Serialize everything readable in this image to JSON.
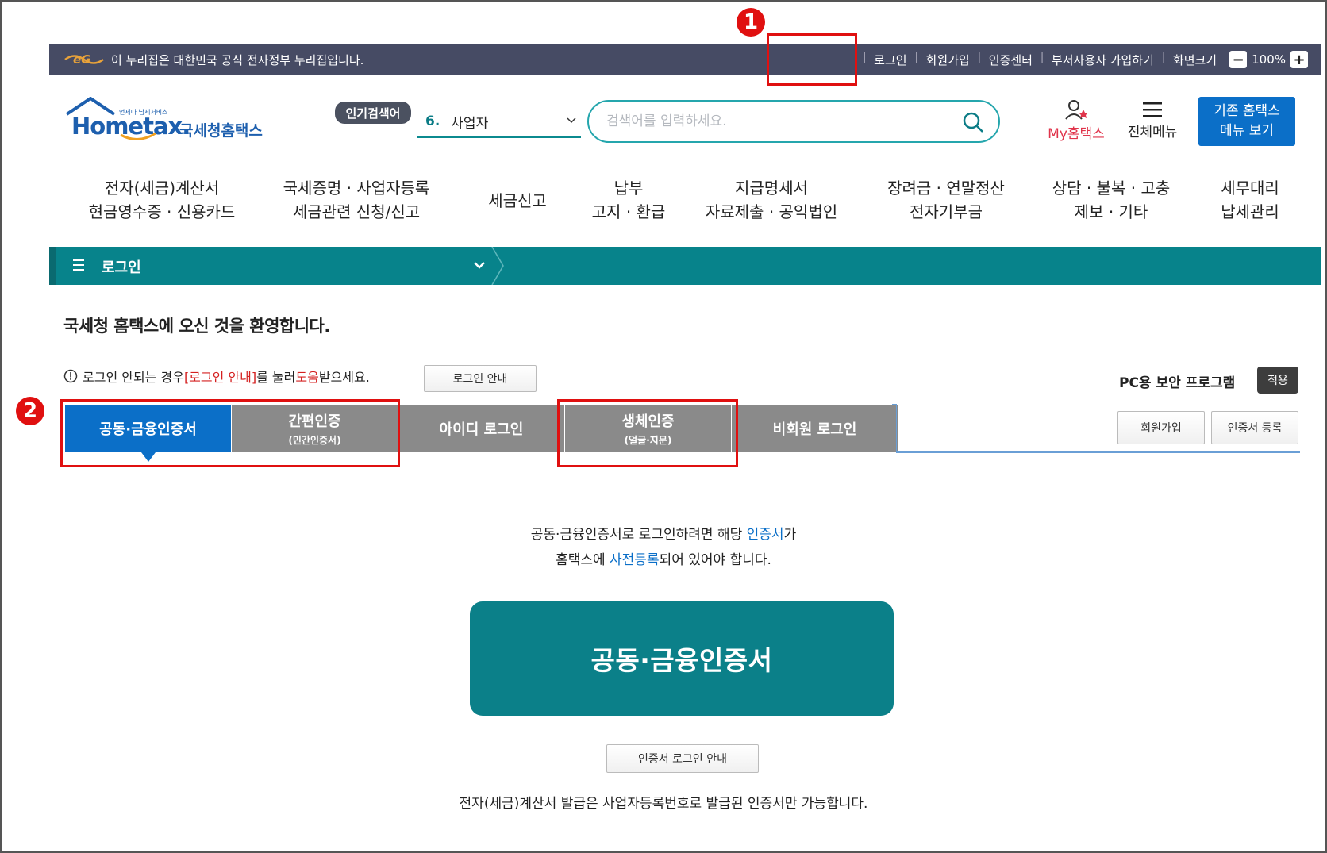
{
  "govbar": {
    "text": "이 누리집은 대한민국 공식 전자정부 누리집입니다.",
    "login": "로그인",
    "signup": "회원가입",
    "cert_center": "인증센터",
    "dept_signup": "부서사용자 가입하기",
    "screen_size": "화면크기",
    "zoom_minus": "−",
    "zoom_value": "100%",
    "zoom_plus": "+"
  },
  "header": {
    "logo_small": "언제나 납세서비스",
    "logo_main": "Hometax.",
    "logo_kr": "국세청홈택스",
    "popular_badge": "인기검색어",
    "popular_rank": "6.",
    "popular_term": "사업자",
    "search_placeholder": "검색어를 입력하세요.",
    "my_hometax": "My홈택스",
    "all_menu": "전체메뉴",
    "old_menu_line1": "기존 홈택스",
    "old_menu_line2": "메뉴 보기"
  },
  "gnb": [
    {
      "line1": "전자(세금)계산서",
      "line2": "현금영수증 · 신용카드"
    },
    {
      "line1": "국세증명 · 사업자등록",
      "line2": "세금관련 신청/신고"
    },
    {
      "line1": "세금신고",
      "line2": ""
    },
    {
      "line1": "납부",
      "line2": "고지 · 환급"
    },
    {
      "line1": "지급명세서",
      "line2": "자료제출 · 공익법인"
    },
    {
      "line1": "장려금 · 연말정산",
      "line2": "전자기부금"
    },
    {
      "line1": "상담 · 불복 · 고충",
      "line2": "제보 · 기타"
    },
    {
      "line1": "세무대리",
      "line2": "납세관리"
    }
  ],
  "location": {
    "label": "로그인"
  },
  "welcome": "국세청 홈택스에 오신 것을 환영합니다.",
  "help": {
    "part1": "로그인 안되는 경우 ",
    "link": "[로그인 안내]",
    "part2": "를 눌러 ",
    "red2": "도움",
    "part3": "받으세요.",
    "button": "로그인 안내"
  },
  "security": {
    "label": "PC용 보안 프로그램",
    "apply": "적용"
  },
  "tabs": [
    {
      "label": "공동·금융인증서",
      "sub": ""
    },
    {
      "label": "간편인증",
      "sub": "(민간인증서)"
    },
    {
      "label": "아이디 로그인",
      "sub": ""
    },
    {
      "label": "생체인증",
      "sub": "(얼굴·지문)"
    },
    {
      "label": "비회원 로그인",
      "sub": ""
    }
  ],
  "side_buttons": {
    "join": "회원가입",
    "cert_register": "인증서 등록"
  },
  "callouts": {
    "one": "1",
    "two": "2"
  },
  "content": {
    "desc1_a": "공동·금융인증서로 로그인하려면 해당 ",
    "desc1_blue": "인증서",
    "desc1_b": "가",
    "desc2_a": "홈택스에 ",
    "desc2_blue": "사전등록",
    "desc2_b": "되어 있어야 합니다.",
    "big_button": "공동·금융인증서",
    "guide_button": "인증서 로그인 안내",
    "footnote": "전자(세금)계산서 발급은 사업자등록번호로 발급된 인증서만 가능합니다."
  },
  "colors": {
    "teal": "#07838b",
    "blue": "#0b6fc8",
    "navy": "#464b64",
    "red_highlight": "#e01010"
  }
}
